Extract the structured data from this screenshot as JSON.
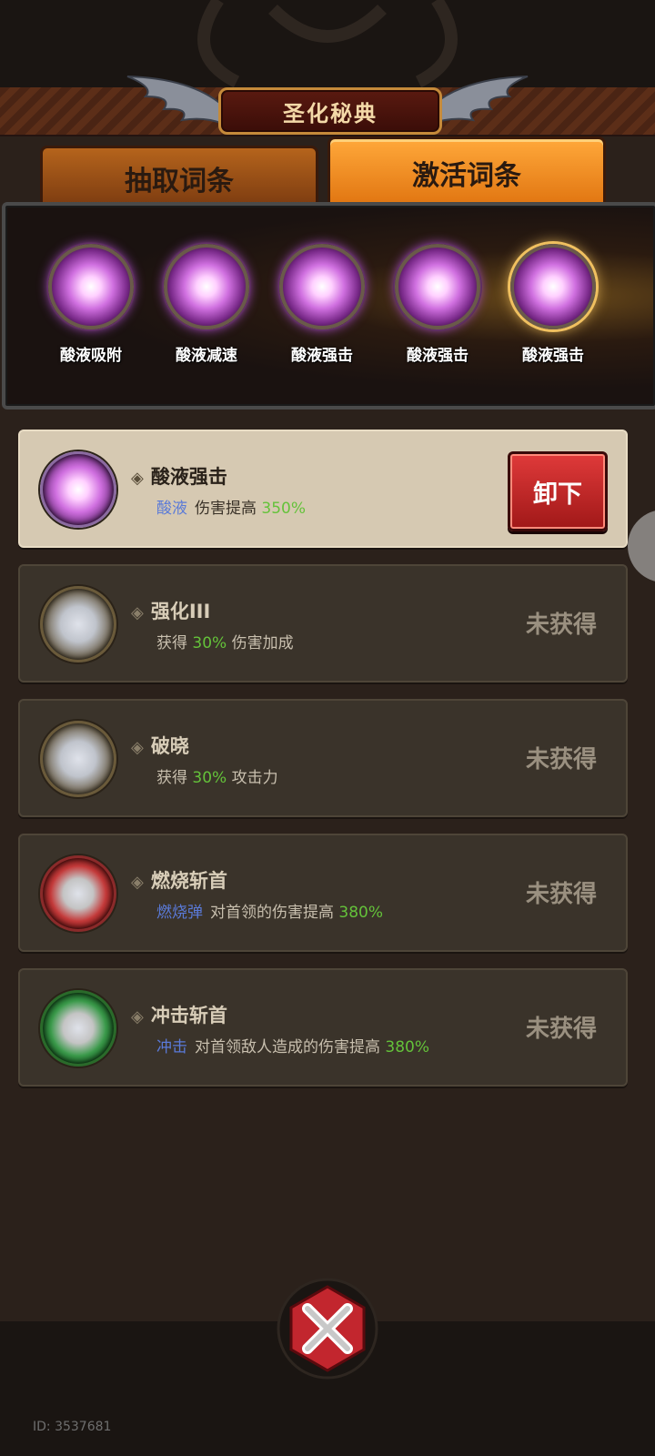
{
  "header": {
    "title": "圣化秘典"
  },
  "tabs": [
    {
      "label": "抽取词条",
      "active": false
    },
    {
      "label": "激活词条",
      "active": true
    }
  ],
  "slots": [
    {
      "label": "酸液吸附"
    },
    {
      "label": "酸液减速"
    },
    {
      "label": "酸液强击"
    },
    {
      "label": "酸液强击"
    },
    {
      "label": "酸液强击",
      "selected": true
    }
  ],
  "entries": [
    {
      "name": "酸液强击",
      "keyword": "酸液",
      "desc": "伤害提高",
      "value": "350%",
      "suffix": "",
      "action": "卸下",
      "active": true,
      "color": "#c46ad8"
    },
    {
      "name": "强化III",
      "keyword": "",
      "desc_prefix": "获得",
      "value": "30%",
      "suffix": "伤害加成",
      "status": "未获得",
      "color": "#b8a88a"
    },
    {
      "name": "破晓",
      "keyword": "",
      "desc_prefix": "获得",
      "value": "30%",
      "suffix": "攻击力",
      "status": "未获得",
      "color": "#b8a88a"
    },
    {
      "name": "燃烧斩首",
      "keyword": "燃烧弹",
      "desc": "对首领的伤害提高",
      "value": "380%",
      "suffix": "",
      "status": "未获得",
      "color": "#c43a3a"
    },
    {
      "name": "冲击斩首",
      "keyword": "冲击",
      "desc": "对首领敌人造成的伤害提高",
      "value": "380%",
      "suffix": "",
      "status": "未获得",
      "color": "#3a9a4a"
    }
  ],
  "footer": {
    "id_text": "ID: 3537681"
  },
  "icons": {
    "close": "close-x-icon",
    "diamond": "◈"
  }
}
